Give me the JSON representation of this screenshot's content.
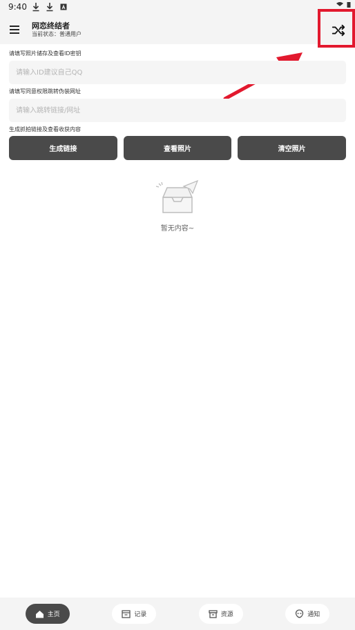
{
  "status": {
    "time": "9:40"
  },
  "app": {
    "title": "网恋终结者",
    "subtitle": "当前状态：普通用户"
  },
  "form": {
    "id_label": "请填写照片储存及查看ID密钥",
    "id_placeholder": "请输入ID建议自己QQ",
    "url_label": "请填写同意权限跳转伪装网址",
    "url_placeholder": "请输入跳转链接/网址",
    "actions_label": "生成抓拍链接及查看收获内容"
  },
  "buttons": {
    "generate": "生成链接",
    "view": "查看照片",
    "clear": "清空照片"
  },
  "empty": {
    "text": "暂无内容~"
  },
  "nav": {
    "items": [
      {
        "label": "主页",
        "icon": "home-icon",
        "active": true
      },
      {
        "label": "记录",
        "icon": "record-icon",
        "active": false
      },
      {
        "label": "资源",
        "icon": "archive-icon",
        "active": false
      },
      {
        "label": "通知",
        "icon": "alien-icon",
        "active": false
      }
    ]
  },
  "colors": {
    "accent": "#4a4a4a",
    "highlight": "#e2192e",
    "background": "#ffffff",
    "bar": "#f4f4f4"
  }
}
